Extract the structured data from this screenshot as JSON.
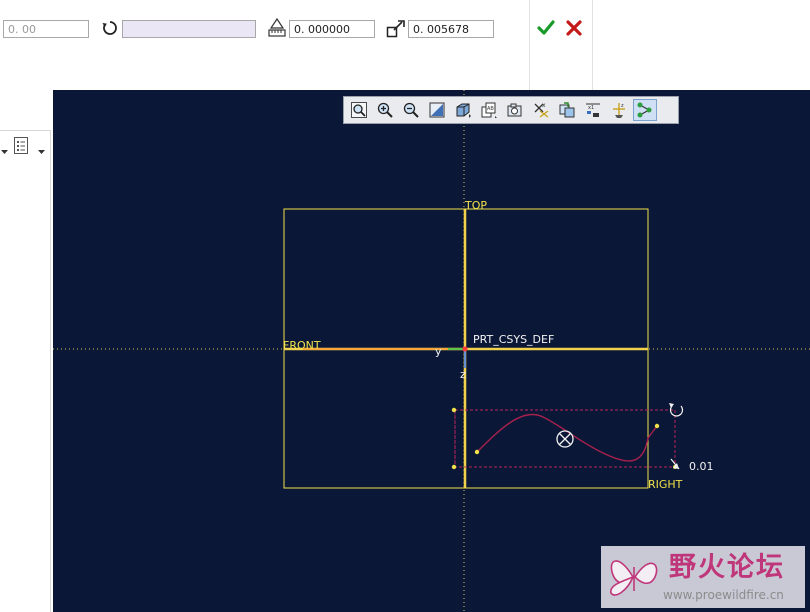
{
  "dashboard": {
    "value_field": "0. 00",
    "rotation_field": "",
    "offset_field": "0. 000000",
    "scale_field": "0. 005678"
  },
  "viewport": {
    "background_color": "#0b1736",
    "datum_color": "#f0e24a",
    "curve_color": "#a8214e",
    "toolbar_icons": [
      "refit-icon",
      "zoom-in-icon",
      "zoom-out-icon",
      "repaint-icon",
      "shading-icon",
      "saved-views-icon",
      "view-manager-icon",
      "datum-planes-icon",
      "datum-axes-icon",
      "datum-points-icon",
      "csys-icon",
      "spin-center-icon"
    ],
    "labels": {
      "top": "TOP",
      "front": "FRONT",
      "right": "RIGHT",
      "csys": "PRT_CSYS_DEF",
      "axis_y": "y",
      "axis_z": "z",
      "dimension": "0.01"
    }
  },
  "watermark": {
    "title": "野火论坛",
    "url": "www.proewildfire.cn"
  }
}
